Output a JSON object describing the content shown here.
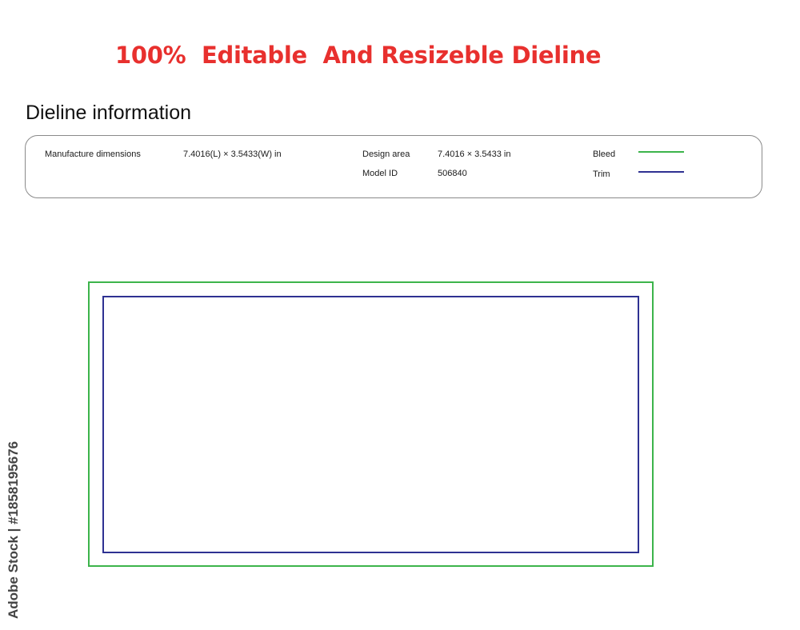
{
  "headline": {
    "text": "100%  Editable  And Resizeble Dieline",
    "color": "#e8302e"
  },
  "section_title": "Dieline information",
  "info": {
    "manufacture_label": "Manufacture dimensions",
    "manufacture_value": "7.4016(L) × 3.5433(W) in",
    "design_area_label": "Design area",
    "design_area_value": "7.4016 × 3.5433 in",
    "model_id_label": "Model ID",
    "model_id_value": "506840"
  },
  "legend": [
    {
      "label": "Bleed",
      "color": "#3cb44b"
    },
    {
      "label": "Trim",
      "color": "#2e3192"
    }
  ],
  "dieline": {
    "bleed_color": "#3cb44b",
    "trim_color": "#2e3192"
  },
  "watermark": "Adobe Stock | #1858195676"
}
